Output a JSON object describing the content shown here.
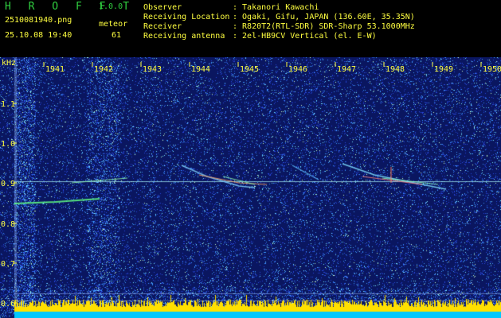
{
  "app": {
    "title": "H R O F F T",
    "version": "1.0.0"
  },
  "capture": {
    "file_name": "2510081940.png",
    "date_time": "25.10.08 19:40",
    "meteor_label": "meteor",
    "meteor_count": "61"
  },
  "info": [
    {
      "key": "Observer",
      "value": ": Takanori Kawachi"
    },
    {
      "key": "Receiving Location",
      "value": ": Ogaki, Gifu, JAPAN (136.60E, 35.35N)"
    },
    {
      "key": "Receiver",
      "value": ": R820T2(RTL-SDR) SDR-Sharp 53.1000MHz"
    },
    {
      "key": "Receiving antenna",
      "value": ": 2el-HB9CV Vertical (el. E-W)"
    }
  ],
  "axes": {
    "y_unit": "kHz",
    "y_ticks": [
      "1.1",
      "1.0",
      "0.9",
      "0.8",
      "0.7",
      "0.6"
    ],
    "x_ticks": [
      "1941",
      "1942",
      "1943",
      "1944",
      "1945",
      "1946",
      "1947",
      "1948",
      "1949",
      "1950"
    ]
  },
  "colors": {
    "background": "#0a1660",
    "carrier": "#b0ffff",
    "text": "#ffff40",
    "title": "#30d040",
    "power_bar": "#ffe000",
    "power_base": "#00c8ff"
  }
}
